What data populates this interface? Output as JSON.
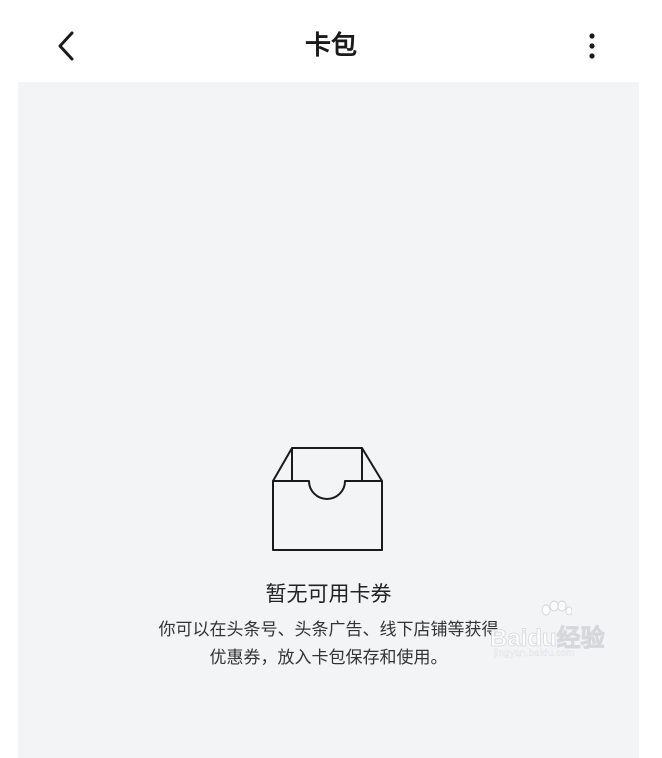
{
  "header": {
    "title": "卡包",
    "back_icon": "chevron-left-icon",
    "more_icon": "more-vertical-icon"
  },
  "empty_state": {
    "icon": "empty-box-icon",
    "title": "暂无可用卡券",
    "description_line1": "你可以在头条号、头条广告、线下店铺等获得",
    "description_line2": "优惠券，放入卡包保存和使用。"
  },
  "watermark": {
    "brand": "Baidu经验",
    "url": "jingyan.baidu.com"
  },
  "colors": {
    "background": "#ffffff",
    "content_background": "#f3f4f6",
    "title_text": "#1a1a1a",
    "body_text": "#333333"
  }
}
